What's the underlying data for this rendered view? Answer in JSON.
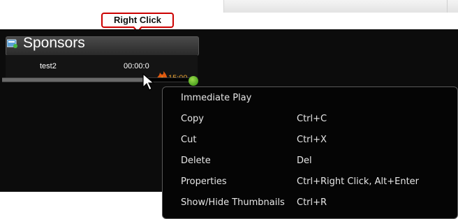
{
  "callout": {
    "text": "Right Click"
  },
  "panel": {
    "title": "Sponsors",
    "icon": "playlist-icon",
    "item": {
      "name": "test2",
      "time": "00:00:0",
      "extra_time": "15:00"
    }
  },
  "context_menu": {
    "items": [
      {
        "label": "Immediate Play",
        "shortcut": ""
      },
      {
        "label": "Copy",
        "shortcut": "Ctrl+C"
      },
      {
        "label": "Cut",
        "shortcut": "Ctrl+X"
      },
      {
        "label": "Delete",
        "shortcut": "Del"
      },
      {
        "label": "Properties",
        "shortcut": "Ctrl+Right Click, Alt+Enter"
      },
      {
        "label": "Show/Hide Thumbnails",
        "shortcut": "Ctrl+R"
      }
    ]
  },
  "progress": {
    "value": 0.72
  },
  "colors": {
    "callout_border": "#cc0000",
    "menu_bg": "#050505",
    "app_bg": "#0c0c0c",
    "status_green": "#3ea81a"
  }
}
